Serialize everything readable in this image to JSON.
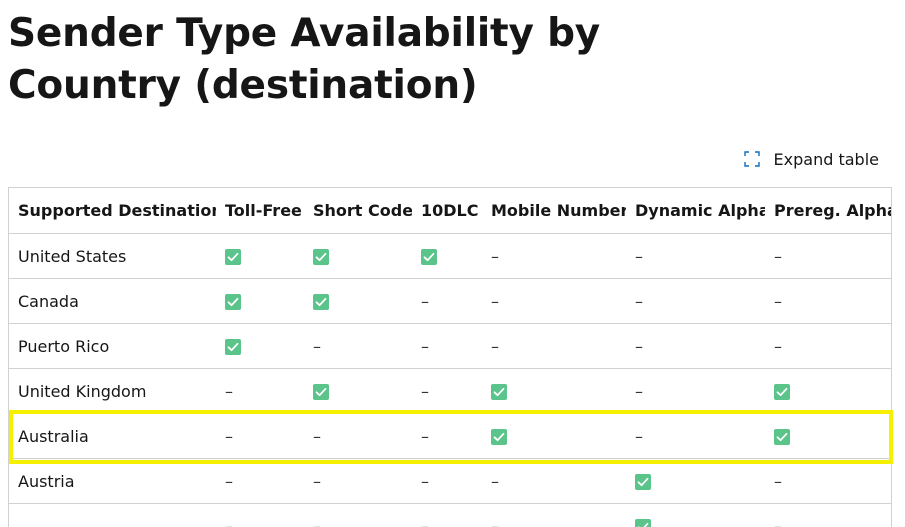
{
  "title": "Sender Type Availability by Country (destination)",
  "expand_label": "Expand table",
  "icons": {
    "expand": "expand-corners-icon",
    "check": "green-checkmark-icon"
  },
  "colors": {
    "check_fill": "#5ac48a",
    "check_mark": "#ffffff",
    "highlight": "#f5ef00",
    "expand_icon": "#0f6cbd"
  },
  "columns": [
    "Supported Destinations",
    "Toll-Free",
    "Short Code",
    "10DLC",
    "Mobile Number",
    "Dynamic Alpha",
    "Prereg. Alpha"
  ],
  "rows": [
    {
      "name": "United States",
      "cells": [
        true,
        true,
        true,
        false,
        false,
        false
      ]
    },
    {
      "name": "Canada",
      "cells": [
        true,
        true,
        false,
        false,
        false,
        false
      ]
    },
    {
      "name": "Puerto Rico",
      "cells": [
        true,
        false,
        false,
        false,
        false,
        false
      ]
    },
    {
      "name": "United Kingdom",
      "cells": [
        false,
        true,
        false,
        true,
        false,
        true
      ]
    },
    {
      "name": "Australia",
      "cells": [
        false,
        false,
        false,
        true,
        false,
        true
      ],
      "highlighted": true
    },
    {
      "name": "Austria",
      "cells": [
        false,
        false,
        false,
        false,
        true,
        false
      ]
    },
    {
      "name": "",
      "cells": [
        false,
        false,
        false,
        false,
        true,
        false
      ]
    }
  ],
  "dash_text": "–"
}
